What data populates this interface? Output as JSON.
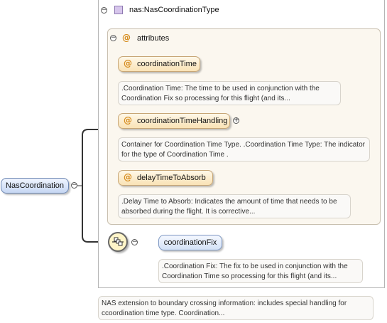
{
  "type": {
    "name": "nas:NasCoordinationType",
    "collapse_symbol": "−"
  },
  "attributes": {
    "group_label": "attributes",
    "at_symbol": "@",
    "collapse_symbol": "−",
    "items": [
      {
        "name": "coordinationTime",
        "doc": ".Coordination Time: The time to be used in conjunction with the Coordination Fix so processing for this flight (and its..."
      },
      {
        "name": "coordinationTimeHandling",
        "expand_symbol": "+",
        "doc": "Container for Coordination Time Type. .Coordination Time Type: The indicator for the type of Coordination Time ."
      },
      {
        "name": "delayTimeToAbsorb",
        "doc": ".Delay Time to Absorb: Indicates the amount of time that needs to be absorbed during the flight. It is corrective..."
      }
    ]
  },
  "root": {
    "name": "NasCoordination",
    "collapse_symbol": "−",
    "doc": "NAS extension to boundary crossing information: includes special handling for ccoordination time type. Coordination..."
  },
  "sequence": {
    "collapse_symbol": "−",
    "child": {
      "name": "coordinationFix",
      "doc": ".Coordination Fix: The fix to be used in conjunction with the Coordination Time so processing for this flight (and its..."
    }
  },
  "colors": {
    "element_fill": "#c6d7f3",
    "attribute_fill": "#f9e2b5",
    "attribute_symbol": "#d58a1a",
    "group_fill": "#fbf7ef",
    "compositor_fill": "#fff5c8"
  }
}
